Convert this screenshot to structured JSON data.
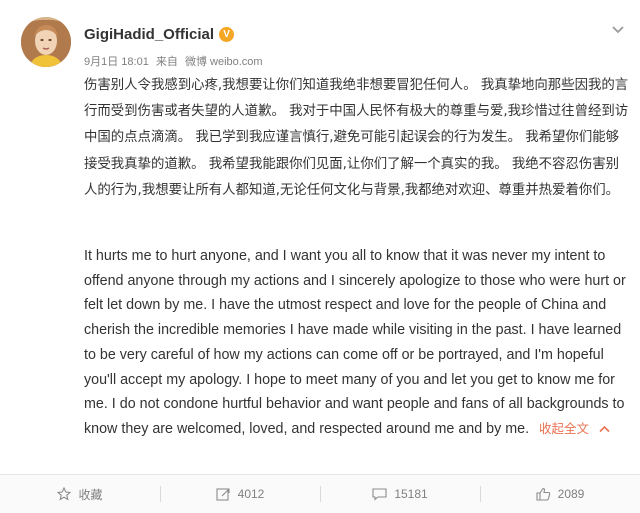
{
  "post": {
    "username": "GigiHadid_Official",
    "date": "9月1日 18:01",
    "source_prefix": "来自",
    "source": "微博 weibo.com",
    "text_zh": "伤害别人令我感到心疼,我想要让你们知道我绝非想要冒犯任何人。 我真挚地向那些因我的言行而受到伤害或者失望的人道歉。 我对于中国人民怀有极大的尊重与爱,我珍惜过往曾经到访中国的点点滴滴。 我已学到我应谨言慎行,避免可能引起误会的行为发生。 我希望你们能够接受我真挚的道歉。 我希望我能跟你们见面,让你们了解一个真实的我。 我绝不容忍伤害别人的行为,我想要让所有人都知道,无论任何文化与背景,我都绝对欢迎、尊重并热爱着你们。",
    "text_en": "It hurts me to hurt anyone, and I want you all to know that it was never my intent to offend anyone through my actions and I sincerely apologize to those who were hurt or felt let down by me. I have the utmost respect and love for the people of China and cherish the incredible memories I have made while visiting in the past. I have learned to be very careful of how my actions can come off or be portrayed, and I'm hopeful you'll accept my apology. I hope to meet many of you and let you get to know me for me. I do not condone hurtful behavior and want people and fans of all backgrounds to know they are welcomed, loved, and respected around me and by me.",
    "collapse_label": "收起全文"
  },
  "actions": {
    "favorite_label": "收藏",
    "repost_count": "4012",
    "comment_count": "15181",
    "like_count": "2089"
  },
  "icons": {
    "verified": "verified-badge-icon",
    "menu": "chevron-down-icon",
    "favorite": "star-icon",
    "repost": "repost-icon",
    "comment": "comment-icon",
    "like": "thumbs-up-icon"
  },
  "colors": {
    "link": "#eb7350",
    "verified": "#f5a623",
    "muted": "#808080"
  }
}
